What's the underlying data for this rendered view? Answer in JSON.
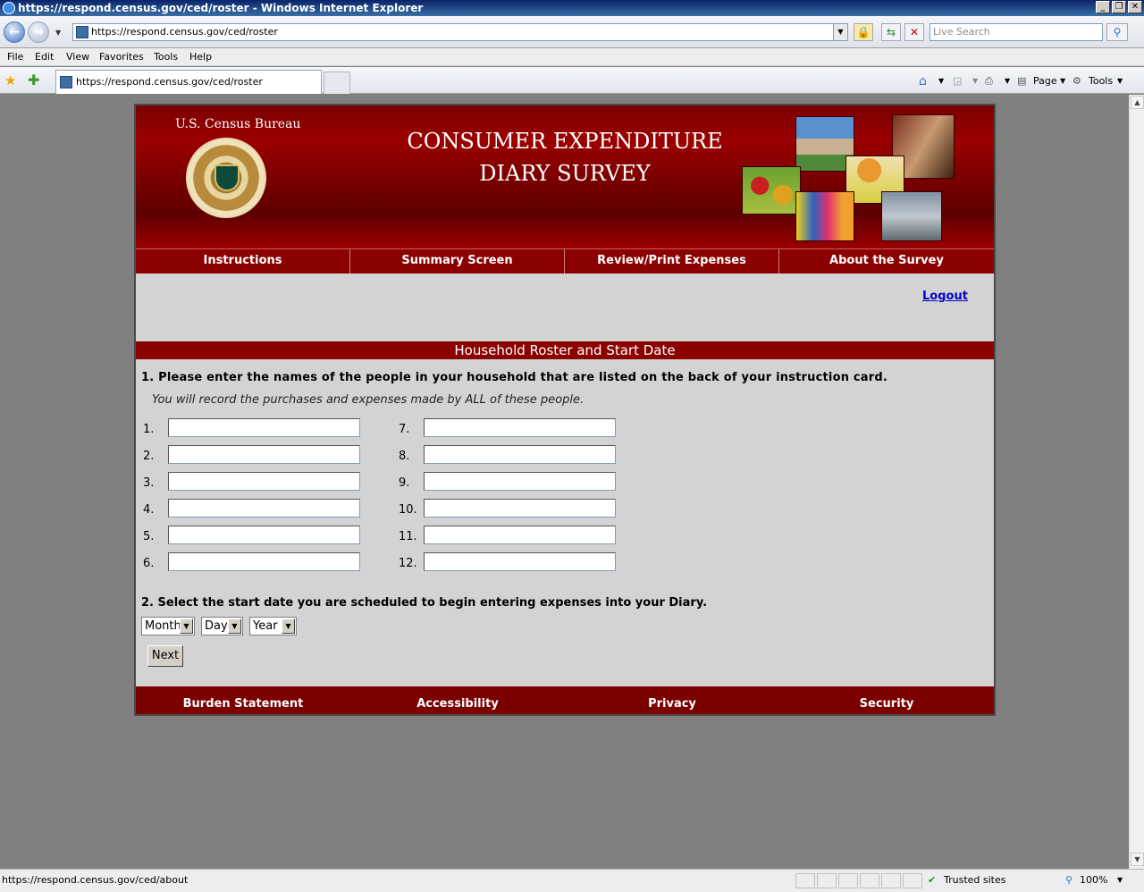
{
  "browser": {
    "title": "https://respond.census.gov/ced/roster - Windows Internet Explorer",
    "address": "https://respond.census.gov/ced/roster",
    "search_placeholder": "Live Search",
    "menu": [
      "File",
      "Edit",
      "View",
      "Favorites",
      "Tools",
      "Help"
    ],
    "tab_title": "https://respond.census.gov/ced/roster",
    "commands": {
      "page": "Page",
      "tools": "Tools"
    },
    "status_url": "https://respond.census.gov/ced/about",
    "zone": "Trusted sites",
    "zoom": "100%"
  },
  "header": {
    "bureau": "U.S. Census Bureau",
    "title_line1": "CONSUMER EXPENDITURE",
    "title_line2": "DIARY SURVEY"
  },
  "nav": [
    "Instructions",
    "Summary Screen",
    "Review/Print Expenses",
    "About the Survey"
  ],
  "logout": "Logout",
  "section_title": "Household Roster and Start Date",
  "question1": "1. Please enter the names of the people in your household that are listed on the back of your instruction card.",
  "question1_note": "You will record the purchases and expenses made by ALL of these people.",
  "roster_numbers": [
    "1.",
    "2.",
    "3.",
    "4.",
    "5.",
    "6.",
    "7.",
    "8.",
    "9.",
    "10.",
    "11.",
    "12."
  ],
  "question2": "2. Select the start date you are scheduled to begin entering expenses into your Diary.",
  "date_selects": {
    "month": "Month",
    "day": "Day",
    "year": "Year"
  },
  "next_label": "Next",
  "footer": [
    "Burden Statement",
    "Accessibility",
    "Privacy",
    "Security"
  ]
}
